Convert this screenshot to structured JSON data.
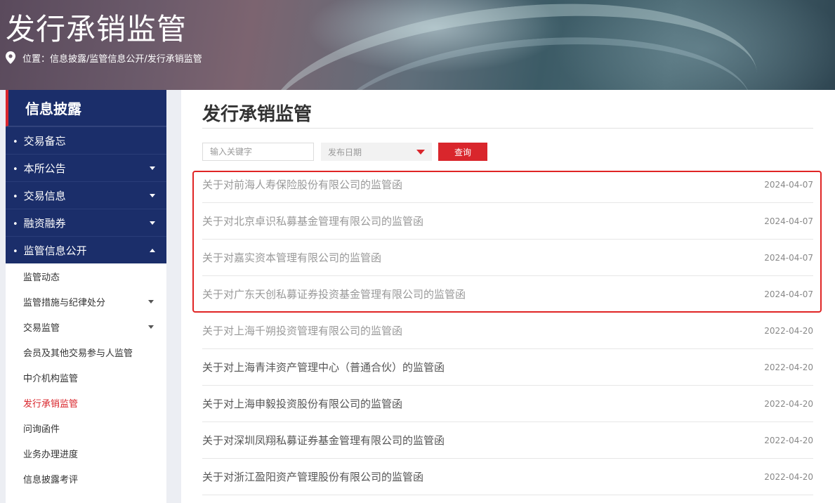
{
  "banner": {
    "title": "发行承销监管",
    "breadcrumb": "位置：信息披露/监管信息公开/发行承销监管"
  },
  "sidebar": {
    "header": "信息披露",
    "items": [
      {
        "label": "交易备忘",
        "caret": "none"
      },
      {
        "label": "本所公告",
        "caret": "down"
      },
      {
        "label": "交易信息",
        "caret": "down"
      },
      {
        "label": "融资融券",
        "caret": "down"
      },
      {
        "label": "监管信息公开",
        "caret": "up"
      }
    ],
    "subitems": [
      {
        "label": "监管动态",
        "caret": false,
        "active": false
      },
      {
        "label": "监管措施与纪律处分",
        "caret": true,
        "active": false
      },
      {
        "label": "交易监管",
        "caret": true,
        "active": false
      },
      {
        "label": "会员及其他交易参与人监管",
        "caret": false,
        "active": false
      },
      {
        "label": "中介机构监管",
        "caret": false,
        "active": false
      },
      {
        "label": "发行承销监管",
        "caret": false,
        "active": true
      },
      {
        "label": "问询函件",
        "caret": false,
        "active": false
      },
      {
        "label": "业务办理进度",
        "caret": false,
        "active": false
      },
      {
        "label": "信息披露考评",
        "caret": false,
        "active": false
      }
    ]
  },
  "main": {
    "title": "发行承销监管",
    "search": {
      "placeholder": "输入关键字",
      "value": ""
    },
    "date_select": "发布日期",
    "query_label": "查询",
    "rows": [
      {
        "title": "关于对前海人寿保险股份有限公司的监管函",
        "date": "2024-04-07"
      },
      {
        "title": "关于对北京卓识私募基金管理有限公司的监管函",
        "date": "2024-04-07"
      },
      {
        "title": "关于对嘉实资本管理有限公司的监管函",
        "date": "2024-04-07"
      },
      {
        "title": "关于对广东天创私募证券投资基金管理有限公司的监管函",
        "date": "2024-04-07"
      },
      {
        "title": "关于对上海千朔投资管理有限公司的监管函",
        "date": "2022-04-20"
      },
      {
        "title": "关于对上海青沣资产管理中心（普通合伙）的监管函",
        "date": "2022-04-20"
      },
      {
        "title": "关于对上海申毅投资股份有限公司的监管函",
        "date": "2022-04-20"
      },
      {
        "title": "关于对深圳凤翔私募证券基金管理有限公司的监管函",
        "date": "2022-04-20"
      },
      {
        "title": "关于对浙江盈阳资产管理股份有限公司的监管函",
        "date": "2022-04-20"
      }
    ]
  },
  "colors": {
    "navy": "#1b2e6a",
    "accent_red": "#d9262c",
    "highlight_red": "#e02424"
  }
}
